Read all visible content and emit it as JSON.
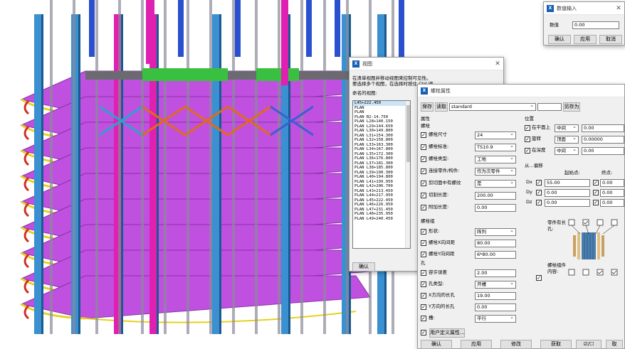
{
  "numeric_input": {
    "title": "数值输入",
    "field_label": "数值",
    "field_value": "0.00",
    "confirm": "确认",
    "apply": "应用",
    "cancel": "取消"
  },
  "views_dialog": {
    "title": "视图",
    "instructions": [
      "在清单视图并移动视图来控制可见性。",
      "要选择多个视图，在选择时按住 Ctrl 键。"
    ],
    "list_label": "命名的视图:",
    "items": [
      "L45+222.450",
      "PLAN",
      "PLAN",
      "PLAN B2-14.750",
      "PLAN L28+140.150",
      "PLAN L29+144.650",
      "PLAN L30+149.800",
      "PLAN L31+154.300",
      "PLAN L32+158.800",
      "PLAN L33+163.300",
      "PLAN L34+167.800",
      "PLAN L35+172.300",
      "PLAN L36+176.800",
      "PLAN L37+181.300",
      "PLAN L38+185.800",
      "PLAN L39+190.300",
      "PLAN L40+194.800",
      "PLAN L41+199.950",
      "PLAN L42+206.700",
      "PLAN L43+213.450",
      "PLAN L44+217.950",
      "PLAN L45+222.450",
      "PLAN L46+226.950",
      "PLAN L47+231.450",
      "PLAN L48+235.950",
      "PLAN L49+240.450"
    ],
    "confirm": "确认"
  },
  "bolt_dialog": {
    "title": "螺栓属性",
    "toolbar": {
      "save": "保存",
      "load": "读取",
      "preset": "standard",
      "save_as_btn": "另存为"
    },
    "props_section": "属性",
    "bolt_section": "螺栓",
    "fields": [
      {
        "label": "螺栓尺寸",
        "value": "24",
        "kind": "select"
      },
      {
        "label": "螺栓标准:",
        "value": "TS10.9",
        "kind": "select"
      },
      {
        "label": "螺栓类型:",
        "value": "工地",
        "kind": "select"
      },
      {
        "label": "连接零件/构件:",
        "value": "作为次零件",
        "kind": "select"
      },
      {
        "label": "剪切面中有螺纹",
        "value": "是",
        "kind": "select"
      },
      {
        "label": "切割长度:",
        "value": "200.00",
        "kind": "input"
      },
      {
        "label": "附加长度:",
        "value": "0.00",
        "kind": "input"
      }
    ],
    "group_section": "螺栓组",
    "group_fields": [
      {
        "label": "形状:",
        "value": "阵列",
        "kind": "select"
      },
      {
        "label": "螺栓X向间距",
        "value": "80.00",
        "kind": "input"
      },
      {
        "label": "螺栓Y向间距",
        "value": "6*80.00",
        "kind": "input"
      }
    ],
    "hole_section": "孔",
    "hole_fields": [
      {
        "label": "容许误差",
        "value": "2.00",
        "kind": "input"
      },
      {
        "label": "孔类型:",
        "value": "开槽",
        "kind": "select"
      },
      {
        "label": "X方向的长孔",
        "value": "19.00",
        "kind": "input"
      },
      {
        "label": "Y方向的长孔",
        "value": "0.00",
        "kind": "input"
      },
      {
        "label": "槽:",
        "value": "平行",
        "kind": "select"
      }
    ],
    "user_attr_btn": "用户定义属性...",
    "position_section": "位置",
    "position_fields": [
      {
        "label": "在平面上",
        "select": "中间",
        "value": "0.00"
      },
      {
        "label": "旋转",
        "select": "顶面",
        "value": "0.00000"
      },
      {
        "label": "在深度",
        "select": "中间",
        "value": "0.00"
      }
    ],
    "offset_section": "从...偏移",
    "start_label": "起始点:",
    "end_label": "终点:",
    "offsets": [
      {
        "axis": "Dx",
        "start": "55.00",
        "end": "0.00"
      },
      {
        "axis": "Dy",
        "start": "0.00",
        "end": "0.00"
      },
      {
        "axis": "Dz",
        "start": "0.00",
        "end": "0.00"
      }
    ],
    "parts_label": "零件有长孔:",
    "assembly_label": "螺栓组件内容:",
    "buttons": {
      "confirm": "确认",
      "apply": "应用",
      "modify": "修改",
      "get": "获取",
      "toggle": "☑/☐",
      "cancel": "取"
    }
  }
}
